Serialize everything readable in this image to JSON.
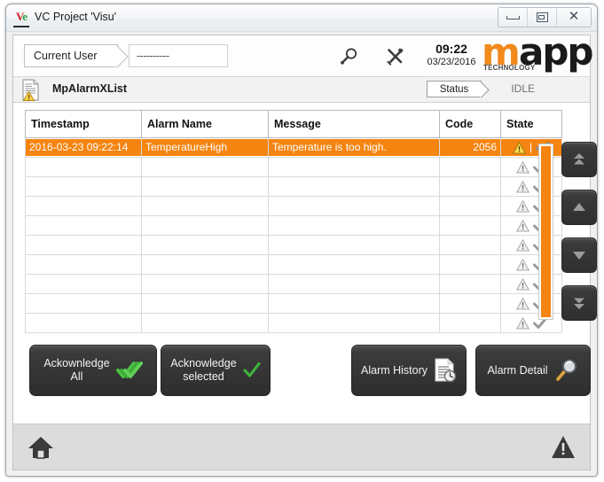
{
  "window": {
    "title": "VC Project 'Visu'",
    "icon": "vc-app-icon",
    "icon_text_left": "V",
    "icon_text_right": "e",
    "buttons": {
      "minimize": "minimize-icon",
      "restore": "restore-icon",
      "close": "close-icon",
      "close_glyph": "✕"
    }
  },
  "header": {
    "user_label": "Current User",
    "user_value": "----------",
    "search_icon": "magnifier-icon",
    "tools_icon": "tools-icon",
    "time": "09:22",
    "date": "03/23/2016",
    "logo": {
      "part_orange": "m",
      "part_dark": "app",
      "subtitle": "TECHNOLOGY",
      "orange": "#F18A1B",
      "dark": "#1A1A1A"
    }
  },
  "panel": {
    "icon": "document-warning-icon",
    "title": "MpAlarmXList",
    "status_label": "Status",
    "status_value": "IDLE"
  },
  "table": {
    "columns": [
      "Timestamp",
      "Alarm Name",
      "Message",
      "Code",
      "State"
    ],
    "rows": [
      {
        "timestamp": "2016-03-23 09:22:14",
        "name": "TemperatureHigh",
        "message": "Temperature is too high.",
        "code": "2056",
        "selected": true
      },
      {
        "timestamp": "",
        "name": "",
        "message": "",
        "code": "",
        "selected": false
      },
      {
        "timestamp": "",
        "name": "",
        "message": "",
        "code": "",
        "selected": false
      },
      {
        "timestamp": "",
        "name": "",
        "message": "",
        "code": "",
        "selected": false
      },
      {
        "timestamp": "",
        "name": "",
        "message": "",
        "code": "",
        "selected": false
      },
      {
        "timestamp": "",
        "name": "",
        "message": "",
        "code": "",
        "selected": false
      },
      {
        "timestamp": "",
        "name": "",
        "message": "",
        "code": "",
        "selected": false
      },
      {
        "timestamp": "",
        "name": "",
        "message": "",
        "code": "",
        "selected": false
      },
      {
        "timestamp": "",
        "name": "",
        "message": "",
        "code": "",
        "selected": false
      },
      {
        "timestamp": "",
        "name": "",
        "message": "",
        "code": "",
        "selected": false
      }
    ],
    "row_count": 10,
    "state_separator": "|",
    "selected_row_color": "#F58410"
  },
  "nav": {
    "first": "double-up-arrow-icon",
    "up": "up-arrow-icon",
    "down": "down-arrow-icon",
    "last": "double-down-arrow-icon"
  },
  "scrollbar": {
    "thumb_color": "#F58410"
  },
  "actions": {
    "ack_all": {
      "line1": "Ackownledge",
      "line2": "All",
      "icon": "triple-check-icon"
    },
    "ack_selected": {
      "line1": "Acknowledge",
      "line2": "selected",
      "icon": "check-icon"
    },
    "alarm_history": {
      "label": "Alarm History",
      "icon": "document-clock-icon"
    },
    "alarm_detail": {
      "label": "Alarm Detail",
      "icon": "magnifier-icon"
    }
  },
  "footer": {
    "home_icon": "home-icon",
    "warning_icon": "warning-triangle-icon"
  }
}
